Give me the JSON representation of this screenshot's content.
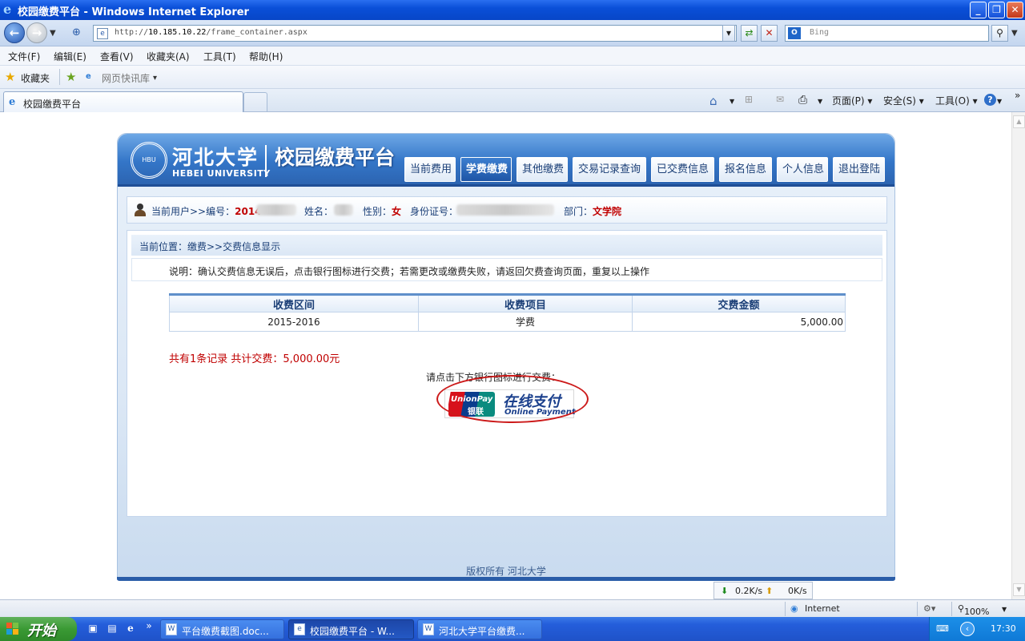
{
  "browser": {
    "title": "校园缴费平台 - Windows Internet Explorer",
    "address_prefix": "http://",
    "address_host": "10.185.10.22",
    "address_path": "/frame_container.aspx",
    "search_placeholder": "Bing",
    "menu": [
      "文件(F)",
      "编辑(E)",
      "查看(V)",
      "收藏夹(A)",
      "工具(T)",
      "帮助(H)"
    ],
    "favorites_label": "收藏夹",
    "web_slice_label": "网页快讯库",
    "tab_label": "校园缴费平台",
    "commands": {
      "page": "页面(P)",
      "safety": "安全(S)",
      "tools": "工具(O)"
    },
    "speed_down": "0.2K/s",
    "speed_up": "0K/s",
    "status_zone": "Internet",
    "zoom": "100%"
  },
  "site": {
    "logo_cn": "河北大学",
    "logo_en": "HEBEI UNIVERSITY",
    "system_title": "校园缴费平台",
    "nav": [
      {
        "label": "当前费用",
        "active": false
      },
      {
        "label": "学费缴费",
        "active": true
      },
      {
        "label": "其他缴费",
        "active": false
      },
      {
        "label": "交易记录查询",
        "active": false
      },
      {
        "label": "已交费信息",
        "active": false
      },
      {
        "label": "报名信息",
        "active": false
      },
      {
        "label": "个人信息",
        "active": false
      },
      {
        "label": "退出登陆",
        "active": false
      }
    ],
    "user": {
      "prefix": "当前用户>>编号：",
      "id_visible": "2014",
      "name_label": "姓名：",
      "gender_label": "性别：",
      "gender": "女",
      "idcard_label": "身份证号：",
      "dept_label": "部门：",
      "dept": "文学院"
    },
    "location": "当前位置：缴费>>交费信息显示",
    "note": "说明：确认交费信息无误后，点击银行图标进行交费；若需更改或缴费失败，请返回欠费查询页面，重复以上操作",
    "table": {
      "headers": [
        "收费区间",
        "收费项目",
        "交费金额"
      ],
      "rows": [
        [
          "2015-2016",
          "学费",
          "5,000.00"
        ]
      ]
    },
    "summary": "共有1条记录 共计交费：5,000.00元",
    "bank_prompt": "请点击下方银行图标进行交费：",
    "unionpay": {
      "brand": "UnionPay",
      "brand_cn": "银联",
      "title_cn": "在线支付",
      "title_en": "Online Payment"
    },
    "footer": "版权所有 河北大学"
  },
  "taskbar": {
    "start": "开始",
    "tasks": [
      {
        "label": "平台缴费截图.doc...",
        "active": false
      },
      {
        "label": "校园缴费平台 - W...",
        "active": true
      },
      {
        "label": "河北大学平台缴费...",
        "active": false
      }
    ],
    "clock": "17:30"
  }
}
